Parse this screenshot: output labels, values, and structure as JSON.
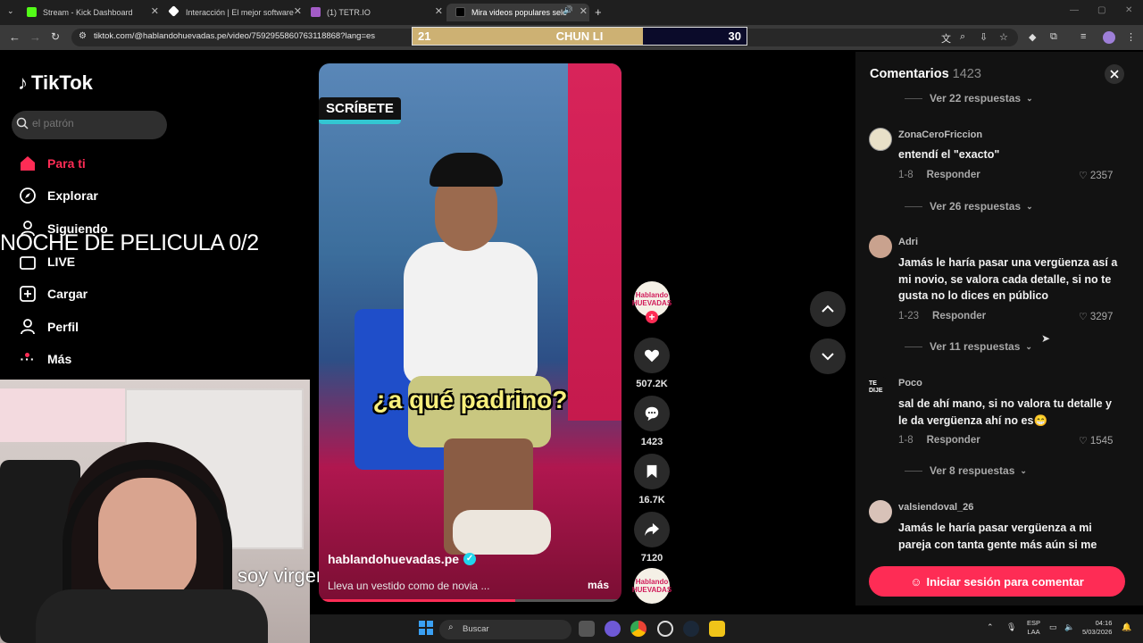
{
  "browser": {
    "tabs": [
      {
        "label": "Stream - Kick Dashboard",
        "favicon_color": "#53fc18"
      },
      {
        "label": "Interacción | El mejor software",
        "favicon_color": "#ffffff"
      },
      {
        "label": "(1) TETR.IO",
        "favicon_color": "#a35cc7"
      },
      {
        "label": "Mira videos populares sele",
        "favicon_color": "#000000"
      }
    ],
    "url": "tiktok.com/@hablandohuevadas.pe/video/7592955860763118868?lang=es"
  },
  "game_overlay": {
    "left_score": "21",
    "title": "CHUN LI",
    "right_score": "30",
    "left_fill_fraction": 0.69
  },
  "tiktok": {
    "logo": "TikTok",
    "search_placeholder": "el patrón",
    "nav": [
      {
        "label": "Para ti",
        "icon": "home-icon"
      },
      {
        "label": "Explorar",
        "icon": "compass-icon"
      },
      {
        "label": "Siguiendo",
        "icon": "user-icon"
      },
      {
        "label": "LIVE",
        "icon": "live-icon"
      },
      {
        "label": "Cargar",
        "icon": "plus-square-icon"
      },
      {
        "label": "Perfil",
        "icon": "profile-icon"
      },
      {
        "label": "Más",
        "icon": "more-icon"
      }
    ]
  },
  "stream_overlay": {
    "title": "NOCHE DE PELICULA 0/2",
    "caption": "soy virgen"
  },
  "video": {
    "banner": "SCRÍBETE",
    "subtitle": "¿a qué padrino?",
    "author": "hablandohuevadas.pe",
    "description": "Lleva un vestido como de novia ...",
    "more": "más",
    "progress_fraction": 0.65,
    "likes": "507.2K",
    "comments": "1423",
    "saves": "16.7K",
    "shares": "7120",
    "avatar_text": "Hablando HUEVADAS"
  },
  "comments_panel": {
    "title": "Comentarios",
    "count": "1423",
    "top_replies": "Ver 22 respuestas",
    "items": [
      {
        "user": "ZonaCeroFriccion",
        "text": "entendí el \"exacto\"",
        "date": "1-8",
        "reply": "Responder",
        "likes": "2357",
        "view_replies": "Ver 26 respuestas",
        "avatar_color": "#e8e0c8"
      },
      {
        "user": "Adri",
        "text": "Jamás le haría pasar una vergüenza así a mi novio, se valora cada detalle, si no te gusta no lo dices en público",
        "date": "1-23",
        "reply": "Responder",
        "likes": "3297",
        "view_replies": "Ver 11 respuestas",
        "avatar_color": "#c9a28e"
      },
      {
        "user": "Poco",
        "text": "sal de ahí mano, si no valora tu detalle y le da vergüenza ahí no es😁",
        "date": "1-8",
        "reply": "Responder",
        "likes": "1545",
        "view_replies": "Ver 8 respuestas",
        "avatar_color": "#d23a3a",
        "avatar_text": "TE DIJE"
      },
      {
        "user": "valsiendoval_26",
        "text": "Jamás le haría pasar vergüenza a mi pareja con tanta gente más aún si me",
        "avatar_color": "#d8c2b8"
      }
    ],
    "login_button": "Iniciar sesión para comentar"
  },
  "taskbar": {
    "search_label": "Buscar",
    "lang_line1": "ESP",
    "lang_line2": "LAA",
    "time": "04:16",
    "date": "5/03/2026"
  }
}
